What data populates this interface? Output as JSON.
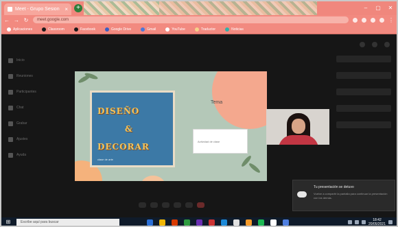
{
  "browser": {
    "tab_title": "Meet - Grupo Sesion",
    "omnibox_text": "meet.google.com",
    "bookmarks": [
      {
        "label": "Aplicaciones",
        "color": "#ffffff"
      },
      {
        "label": "Classroom",
        "color": "#1a1a1a"
      },
      {
        "label": "Facebook",
        "color": "#1a1a1a"
      },
      {
        "label": "Google Drive",
        "color": "#3b5fc2"
      },
      {
        "label": "Gmail",
        "color": "#4a78d9"
      },
      {
        "label": "YouTube",
        "color": "#ffffff"
      },
      {
        "label": "Traductor",
        "color": "#f5d28a"
      },
      {
        "label": "Noticias",
        "color": "#33b0a8"
      }
    ]
  },
  "meet": {
    "left_rail": [
      "Inicio",
      "Reuniones",
      "Participantes",
      "Chat",
      "Grabar",
      "Ajustes",
      "Ayuda"
    ],
    "slide": {
      "poster_lines": [
        "DISEÑO",
        "&",
        "DECORAR"
      ],
      "poster_footer": "clase de arte",
      "title": "Tema",
      "box_text": "Actividad de clase"
    },
    "notification": {
      "title": "Tu presentación se detuvo",
      "body": "Vuelve a compartir la pantalla para continuar la presentación con los demás."
    }
  },
  "taskbar": {
    "search_placeholder": "Escribe aquí para buscar",
    "apps": [
      "#2b6fd6",
      "#f2b705",
      "#d83b01",
      "#2e9c3f",
      "#6b2fb3",
      "#c33",
      "#1d8ad8",
      "#e0e0e0",
      "#f59b2b",
      "#1db954",
      "#ffffff",
      "#4f7fe0"
    ],
    "time": "18:42",
    "date": "20/05/2021"
  },
  "colors": {
    "chrome_accent": "#f0877d",
    "slide_bg": "#b4c8b8",
    "slide_blob": "#f4a88e",
    "poster_bg": "#3c79a6",
    "poster_text": "#f2c45c"
  }
}
